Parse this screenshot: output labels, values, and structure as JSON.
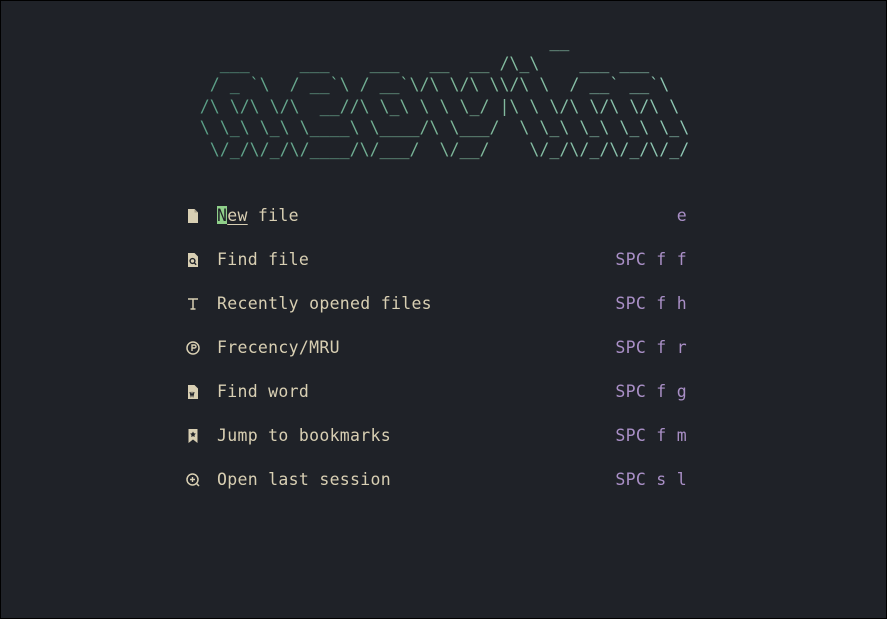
{
  "banner": {
    "ascii": "                                   __\n  ___     ___    ___   __  __ /\\_\\    ___ ___\n / _ `\\  / __`\\ / __`\\/\\ \\/\\ \\\\/\\ \\  / __` __`\\\n/\\ \\/\\ \\/\\  __//\\ \\_\\ \\ \\ \\_/ |\\ \\ \\/\\ \\/\\ \\/\\ \\\n\\ \\_\\ \\_\\ \\____\\ \\____/\\ \\___/  \\ \\_\\ \\_\\ \\_\\ \\_\\\n \\/_/\\/_/\\/____/\\/___/  \\/__/    \\/_/\\/_/\\/_/\\/_/"
  },
  "menu": {
    "items": [
      {
        "icon": "file-icon",
        "label_cursor": "N",
        "label_underlined": "ew",
        "label_rest": " file",
        "shortcut": "e"
      },
      {
        "icon": "search-file-icon",
        "label": "Find file",
        "shortcut": "SPC f f"
      },
      {
        "icon": "history-icon",
        "label": "Recently opened files",
        "shortcut": "SPC f h"
      },
      {
        "icon": "frecency-icon",
        "label": "Frecency/MRU",
        "shortcut": "SPC f r"
      },
      {
        "icon": "word-file-icon",
        "label": "Find word",
        "shortcut": "SPC f g"
      },
      {
        "icon": "bookmark-icon",
        "label": "Jump to bookmarks",
        "shortcut": "SPC f m"
      },
      {
        "icon": "session-icon",
        "label": "Open last session",
        "shortcut": "SPC s l"
      }
    ]
  },
  "colors": {
    "background": "#1f2228",
    "banner": "#7fb89a",
    "text": "#d8cfb3",
    "shortcut": "#a98fc6",
    "cursor": "#8fd08a"
  }
}
